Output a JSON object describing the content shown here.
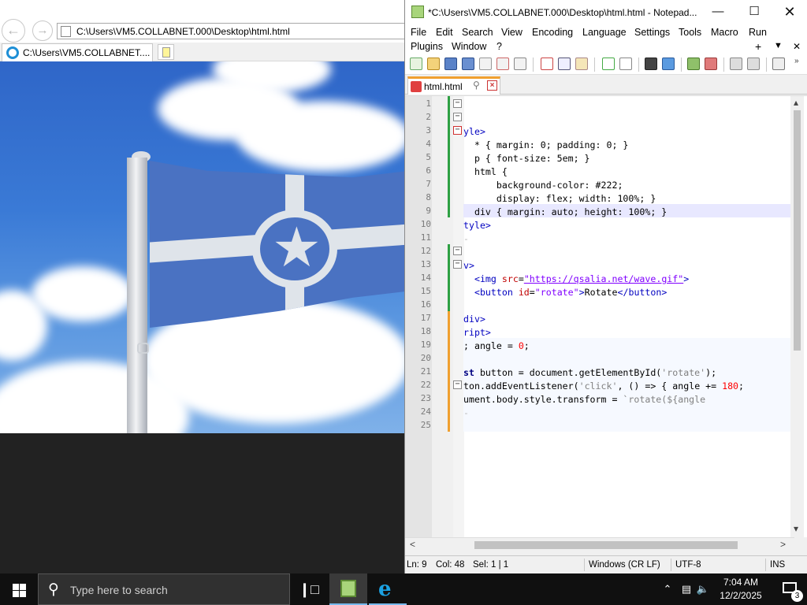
{
  "browser": {
    "address": "C:\\Users\\VM5.COLLABNET.000\\Desktop\\html.html",
    "tab_title": "C:\\Users\\VM5.COLLABNET...."
  },
  "notepad": {
    "title": "*C:\\Users\\VM5.COLLABNET.000\\Desktop\\html.html - Notepad...",
    "menu": [
      "File",
      "Edit",
      "Search",
      "View",
      "Encoding",
      "Language",
      "Settings",
      "Tools",
      "Macro",
      "Run",
      "Plugins",
      "Window",
      "?"
    ],
    "menu_plus": "+",
    "menu_down": "▼",
    "menu_close": "✕",
    "tab_label": "html.html",
    "line_numbers": [
      "1",
      "2",
      "3",
      "4",
      "5",
      "6",
      "7",
      "8",
      "9",
      "10",
      "11",
      "12",
      "13",
      "14",
      "15",
      "16",
      "17",
      "18",
      "19",
      "20",
      "21",
      "22",
      "23",
      "24",
      "25"
    ],
    "status": {
      "ln": "Ln: 9",
      "col": "Col: 48",
      "sel": "Sel: 1 | 1",
      "eol": "Windows (CR LF)",
      "encoding": "UTF-8",
      "mode": "INS"
    }
  },
  "taskbar": {
    "search_placeholder": "Type here to search",
    "time": "7:04 AM",
    "date": "12/2/2025",
    "notifications": "3"
  }
}
